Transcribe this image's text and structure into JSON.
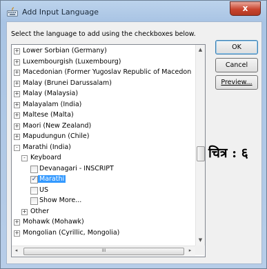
{
  "window": {
    "title": "Add Input Language",
    "close_glyph": "x",
    "title_icon": "keyboard-icon"
  },
  "dialog": {
    "instruction": "Select the language to add using the checkboxes below.",
    "buttons": {
      "ok": "OK",
      "cancel": "Cancel",
      "preview": "Preview..."
    }
  },
  "tree": {
    "rows": [
      {
        "name": "tree-item-lower-sorbian",
        "label": "Lower Sorbian (Germany)",
        "level": 0,
        "expander": "+"
      },
      {
        "name": "tree-item-luxembourgish",
        "label": "Luxembourgish (Luxembourg)",
        "level": 0,
        "expander": "+"
      },
      {
        "name": "tree-item-macedonian",
        "label": "Macedonian (Former Yugoslav Republic of Macedon",
        "level": 0,
        "expander": "+"
      },
      {
        "name": "tree-item-malay-brunei",
        "label": "Malay (Brunei Darussalam)",
        "level": 0,
        "expander": "+"
      },
      {
        "name": "tree-item-malay-malaysia",
        "label": "Malay (Malaysia)",
        "level": 0,
        "expander": "+"
      },
      {
        "name": "tree-item-malayalam",
        "label": "Malayalam (India)",
        "level": 0,
        "expander": "+"
      },
      {
        "name": "tree-item-maltese",
        "label": "Maltese (Malta)",
        "level": 0,
        "expander": "+"
      },
      {
        "name": "tree-item-maori",
        "label": "Maori (New Zealand)",
        "level": 0,
        "expander": "+"
      },
      {
        "name": "tree-item-mapudungun",
        "label": "Mapudungun (Chile)",
        "level": 0,
        "expander": "+"
      },
      {
        "name": "tree-item-marathi",
        "label": "Marathi (India)",
        "level": 0,
        "expander": "-"
      },
      {
        "name": "tree-item-keyboard",
        "label": "Keyboard",
        "level": 1,
        "expander": "-"
      },
      {
        "name": "tree-item-devanagari-inscript",
        "label": "Devanagari - INSCRIPT",
        "level": 2,
        "checkbox": true,
        "checked": false
      },
      {
        "name": "tree-item-marathi-keyboard",
        "label": "Marathi",
        "level": 2,
        "checkbox": true,
        "checked": true,
        "selected": true
      },
      {
        "name": "tree-item-us",
        "label": "US",
        "level": 2,
        "checkbox": true,
        "checked": false
      },
      {
        "name": "tree-item-show-more",
        "label": "Show More...",
        "level": 2,
        "checkbox": true,
        "checked": false
      },
      {
        "name": "tree-item-other",
        "label": "Other",
        "level": 1,
        "expander": "+"
      },
      {
        "name": "tree-item-mohawk",
        "label": "Mohawk (Mohawk)",
        "level": 0,
        "expander": "+"
      },
      {
        "name": "tree-item-mongolian",
        "label": "Mongolian (Cyrillic, Mongolia)",
        "level": 0,
        "expander": "+"
      }
    ],
    "scroll": {
      "up_glyph": "▲",
      "down_glyph": "▼",
      "left_glyph": "◂",
      "right_glyph": "▸",
      "grip_glyph": "III"
    }
  },
  "overlay": {
    "caption": "चित्र : ६"
  },
  "colors": {
    "selection": "#3399ff",
    "titlebar": "#bcd3ec",
    "close": "#c9452f"
  }
}
